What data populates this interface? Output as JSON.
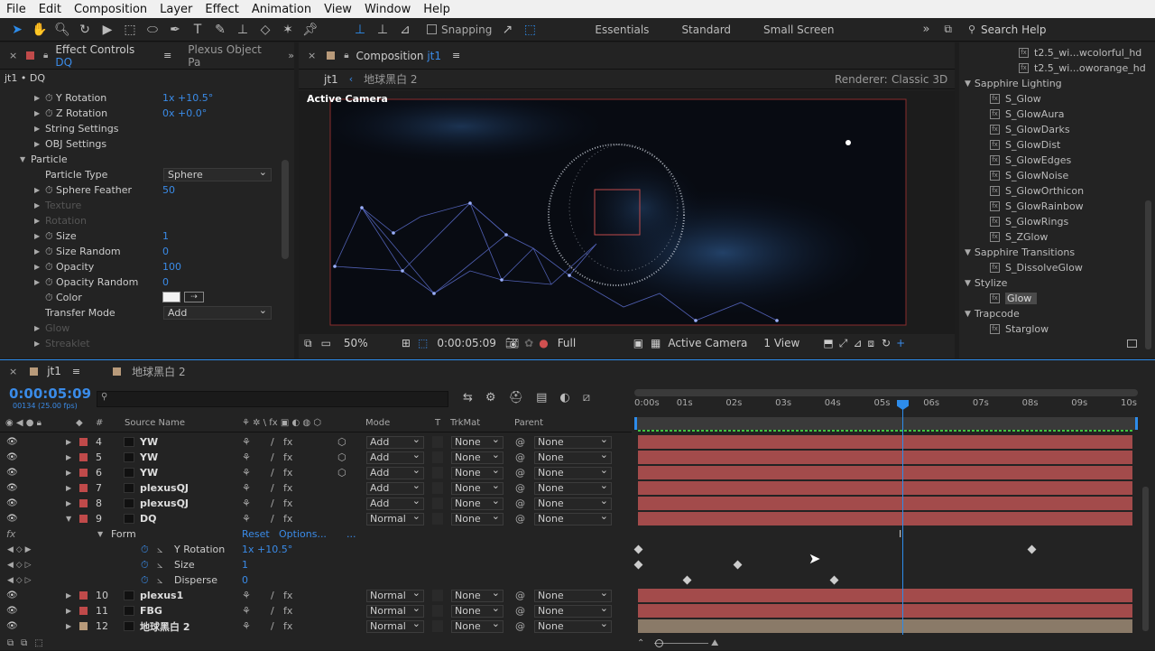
{
  "menu": [
    "File",
    "Edit",
    "Composition",
    "Layer",
    "Effect",
    "Animation",
    "View",
    "Window",
    "Help"
  ],
  "toolbar": {
    "snapping": "Snapping",
    "workspaces": [
      "Essentials",
      "Standard",
      "Small Screen"
    ],
    "search_placeholder": "Search Help"
  },
  "effect_panel": {
    "tab": "Effect Controls",
    "tab_layer": "DQ",
    "tab2": "Plexus Object Pa",
    "breadcrumb": "jt1 • DQ",
    "rows": [
      {
        "label": "Y Rotation",
        "value": "1x +10.5°",
        "indent": 2,
        "stopwatch": true,
        "tri": "▶"
      },
      {
        "label": "Z Rotation",
        "value": "0x +0.0°",
        "indent": 2,
        "stopwatch": true,
        "tri": "▶"
      },
      {
        "label": "String Settings",
        "value": "",
        "indent": 2,
        "stopwatch": false,
        "tri": "▶"
      },
      {
        "label": "OBJ Settings",
        "value": "",
        "indent": 2,
        "stopwatch": false,
        "tri": "▶"
      },
      {
        "label": "Particle",
        "value": "",
        "indent": 1,
        "stopwatch": false,
        "tri": "▼"
      },
      {
        "label": "Particle Type",
        "value": "",
        "indent": 3,
        "stopwatch": false,
        "tri": ""
      },
      {
        "label": "Sphere Feather",
        "value": "50",
        "indent": 2,
        "stopwatch": true,
        "tri": "▶"
      },
      {
        "label": "Texture",
        "value": "",
        "indent": 2,
        "stopwatch": false,
        "tri": "▶",
        "dim": true
      },
      {
        "label": "Rotation",
        "value": "",
        "indent": 2,
        "stopwatch": false,
        "tri": "▶",
        "dim": true
      },
      {
        "label": "Size",
        "value": "1",
        "indent": 2,
        "stopwatch": true,
        "tri": "▶"
      },
      {
        "label": "Size Random",
        "value": "0",
        "indent": 2,
        "stopwatch": true,
        "tri": "▶"
      },
      {
        "label": "Opacity",
        "value": "100",
        "indent": 2,
        "stopwatch": true,
        "tri": "▶"
      },
      {
        "label": "Opacity Random",
        "value": "0",
        "indent": 2,
        "stopwatch": true,
        "tri": "▶"
      },
      {
        "label": "Color",
        "value": "",
        "indent": 3,
        "stopwatch": true,
        "tri": ""
      },
      {
        "label": "Transfer Mode",
        "value": "",
        "indent": 3,
        "stopwatch": false,
        "tri": ""
      },
      {
        "label": "Glow",
        "value": "",
        "indent": 2,
        "stopwatch": false,
        "tri": "▶",
        "dim": true
      },
      {
        "label": "Streaklet",
        "value": "",
        "indent": 2,
        "stopwatch": false,
        "tri": "▶",
        "dim": true
      }
    ],
    "particle_type": "Sphere",
    "transfer_mode": "Add"
  },
  "comp_panel": {
    "tab": "Composition",
    "tab_name": "jt1",
    "crumb1": "jt1",
    "crumb2": "地球黑白 2",
    "renderer_label": "Renderer:",
    "renderer": "Classic 3D",
    "active_camera": "Active Camera",
    "bottom": {
      "zoom": "50%",
      "timecode": "0:00:05:09",
      "quality": "Full",
      "camera": "Active Camera",
      "views": "1 View"
    }
  },
  "effects_list": {
    "items": [
      {
        "label": "t2.5_wi...wcolorful_hd",
        "type": "file",
        "indent": 2
      },
      {
        "label": "t2.5_wi...oworange_hd",
        "type": "file",
        "indent": 2
      },
      {
        "label": "Sapphire Lighting",
        "type": "group",
        "indent": 0
      },
      {
        "label": "S_Glow",
        "type": "fx",
        "indent": 1
      },
      {
        "label": "S_GlowAura",
        "type": "fx",
        "indent": 1
      },
      {
        "label": "S_GlowDarks",
        "type": "fx",
        "indent": 1
      },
      {
        "label": "S_GlowDist",
        "type": "fx",
        "indent": 1
      },
      {
        "label": "S_GlowEdges",
        "type": "fx",
        "indent": 1
      },
      {
        "label": "S_GlowNoise",
        "type": "fx",
        "indent": 1
      },
      {
        "label": "S_GlowOrthicon",
        "type": "fx",
        "indent": 1
      },
      {
        "label": "S_GlowRainbow",
        "type": "fx",
        "indent": 1
      },
      {
        "label": "S_GlowRings",
        "type": "fx",
        "indent": 1
      },
      {
        "label": "S_ZGlow",
        "type": "fx",
        "indent": 1
      },
      {
        "label": "Sapphire Transitions",
        "type": "group",
        "indent": 0
      },
      {
        "label": "S_DissolveGlow",
        "type": "fx",
        "indent": 1
      },
      {
        "label": "Stylize",
        "type": "group",
        "indent": 0
      },
      {
        "label": "Glow",
        "type": "fx",
        "indent": 1,
        "selected": true
      },
      {
        "label": "Trapcode",
        "type": "group",
        "indent": 0
      },
      {
        "label": "Starglow",
        "type": "fx",
        "indent": 1
      }
    ]
  },
  "timeline": {
    "tab": "jt1",
    "tab2": "地球黑白 2",
    "timecode": "0:00:05:09",
    "fps": "00134 (25.00 fps)",
    "columns": {
      "source": "Source Name",
      "mode": "Mode",
      "t": "T",
      "trkmat": "TrkMat",
      "parent": "Parent"
    },
    "ruler": [
      "0:00s",
      "01s",
      "02s",
      "03s",
      "04s",
      "05s",
      "06s",
      "07s",
      "08s",
      "09s",
      "10s"
    ],
    "layers": [
      {
        "num": "4",
        "name": "YW",
        "mode": "Add",
        "trk": "None",
        "parent": "None",
        "cube": true
      },
      {
        "num": "5",
        "name": "YW",
        "mode": "Add",
        "trk": "None",
        "parent": "None",
        "cube": true
      },
      {
        "num": "6",
        "name": "YW",
        "mode": "Add",
        "trk": "None",
        "parent": "None",
        "cube": true
      },
      {
        "num": "7",
        "name": "plexusQJ",
        "mode": "Add",
        "trk": "None",
        "parent": "None",
        "cube": false
      },
      {
        "num": "8",
        "name": "plexusQJ",
        "mode": "Add",
        "trk": "None",
        "parent": "None",
        "cube": false
      },
      {
        "num": "9",
        "name": "DQ",
        "mode": "Normal",
        "trk": "None",
        "parent": "None",
        "cube": false,
        "open": true
      }
    ],
    "form": {
      "label": "Form",
      "reset": "Reset",
      "options": "Options...",
      "more": "...",
      "props": [
        {
          "label": "Y Rotation",
          "value": "1x +10.5°"
        },
        {
          "label": "Size",
          "value": "1"
        },
        {
          "label": "Disperse",
          "value": "0"
        }
      ]
    },
    "layers2": [
      {
        "num": "10",
        "name": "plexus1",
        "mode": "Normal",
        "trk": "None",
        "parent": "None"
      },
      {
        "num": "11",
        "name": "FBG",
        "mode": "Normal",
        "trk": "None",
        "parent": "None"
      },
      {
        "num": "12",
        "name": "地球黑白 2",
        "mode": "Normal",
        "trk": "None",
        "parent": "None",
        "tan": true
      }
    ]
  }
}
